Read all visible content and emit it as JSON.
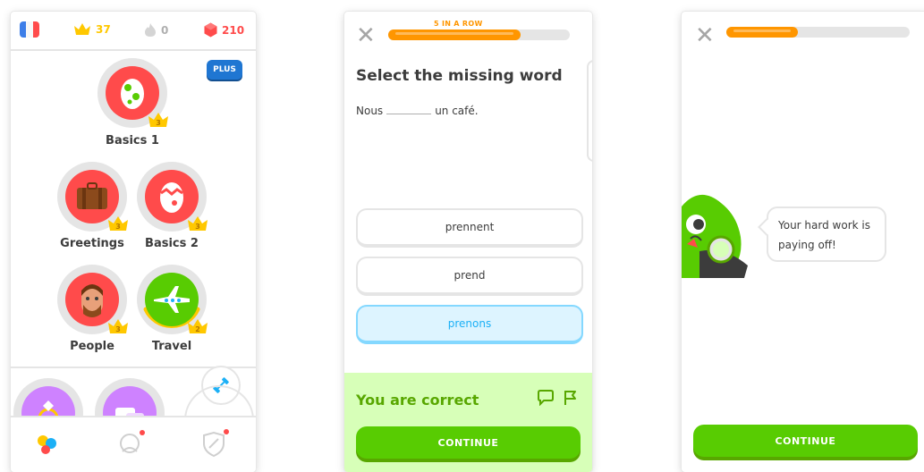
{
  "screen1": {
    "header": {
      "crowns": "37",
      "streak": "0",
      "gems": "210"
    },
    "plus_badge": "PLUS",
    "skills": [
      {
        "label": "Basics 1",
        "level": "3"
      },
      {
        "label": "Greetings",
        "level": "3"
      },
      {
        "label": "Basics 2",
        "level": "3"
      },
      {
        "label": "People",
        "level": "3"
      },
      {
        "label": "Travel",
        "level": "2"
      }
    ],
    "icons": [
      "flag-icon",
      "crown-icon",
      "flame-icon",
      "gem-icon",
      "dumbbell-icon",
      "home-icon",
      "profile-icon",
      "shield-icon"
    ],
    "colors": {
      "skill_red": "#ff4b4b",
      "skill_green": "#58cc02",
      "crown_gold": "#ffc800",
      "plus_blue": "#1f76d2"
    }
  },
  "screen2": {
    "streak_label": "5 IN A ROW",
    "progress": 0.73,
    "question_title": "Select the missing word",
    "sentence_before": "Nous",
    "sentence_after": "un café.",
    "options": [
      "prennent",
      "prend",
      "prenons"
    ],
    "selected_option": "prenons",
    "feedback": "You are correct",
    "continue_label": "CONTINUE",
    "colors": {
      "progress": "#ff9600",
      "correct_bg": "#d7ffb8",
      "correct_text": "#58a700",
      "button": "#58cc02"
    }
  },
  "screen3": {
    "progress": 0.39,
    "bubble_text_line1": "Your hard work is",
    "bubble_text_line2": "paying off!",
    "continue_label": "CONTINUE"
  }
}
